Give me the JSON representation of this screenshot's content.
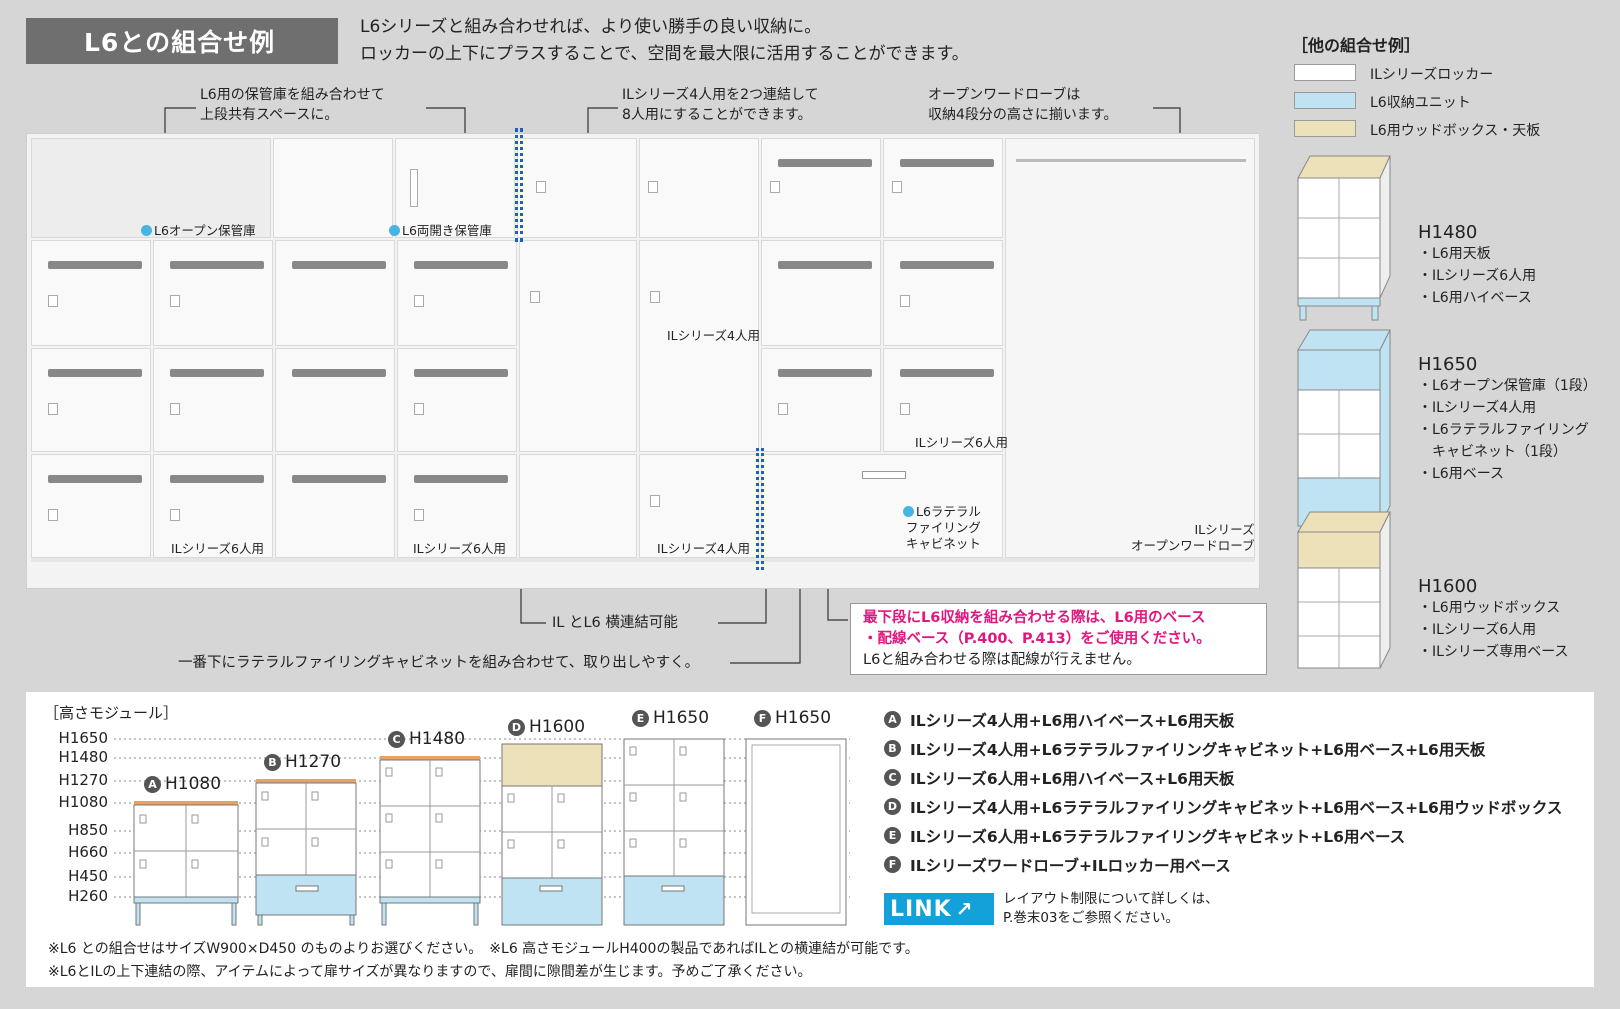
{
  "header": {
    "title": "L6との組合せ例",
    "intro_line1": "L6シリーズと組み合わせれば、より使い勝手の良い収納に。",
    "intro_line2": "ロッカーの上下にプラスすることで、空間を最大限に活用することができます。"
  },
  "callouts": {
    "c1_line1": "L6用の保管庫を組み合わせて",
    "c1_line2": "上段共有スペースに。",
    "c2_line1": "ILシリーズ4人用を2つ連結して",
    "c2_line2": "8人用にすることができます。",
    "c3_line1": "オープンワードローブは",
    "c3_line2": "収納4段分の高さに揃います。",
    "horizontal": "IL とL6 横連結可能",
    "lateral": "一番下にラテラルファイリングキャビネットを組み合わせて、取り出しやすく。"
  },
  "photo_labels": {
    "open_storage": "L6オープン保管庫",
    "double_door": "L6両開き保管庫",
    "il4_mid": "ILシリーズ4人用",
    "il6_right": "ILシリーズ6人用",
    "il6_bottom1": "ILシリーズ6人用",
    "il6_bottom2": "ILシリーズ6人用",
    "il4_bottom": "ILシリーズ4人用",
    "lateral_l1": "L6ラテラル",
    "lateral_l2": "ファイリング",
    "lateral_l3": "キャビネット",
    "wardrobe_l1": "ILシリーズ",
    "wardrobe_l2": "オープンワードローブ"
  },
  "warning": {
    "line1": "最下段にL6収納を組み合わせる際は、L6用のベース",
    "line2": "・配線ベース（P.400、P.413）をご使用ください。",
    "line3": "L6と組み合わせる際は配線が行えません。"
  },
  "right_panel": {
    "heading": "［他の組合せ例］",
    "legend": [
      {
        "label": "ILシリーズロッカー",
        "color": "#ffffff"
      },
      {
        "label": "L6収納ユニット",
        "color": "#bfe3f2"
      },
      {
        "label": "L6用ウッドボックス・天板",
        "color": "#ece1b8"
      }
    ],
    "examples": [
      {
        "height": "H1480",
        "items": [
          "・L6用天板",
          "・ILシリーズ6人用",
          "・L6用ハイベース"
        ]
      },
      {
        "height": "H1650",
        "items": [
          "・L6オープン保管庫（1段）",
          "・ILシリーズ4人用",
          "・L6ラテラルファイリング",
          "　キャビネット（1段）",
          "・L6用ベース"
        ]
      },
      {
        "height": "H1600",
        "items": [
          "・L6用ウッドボックス",
          "・ILシリーズ6人用",
          "・ILシリーズ専用ベース"
        ]
      }
    ]
  },
  "module": {
    "heading": "［高さモジュール］",
    "levels": [
      "H1650",
      "H1480",
      "H1270",
      "H1080",
      "H850",
      "H660",
      "H450",
      "H260"
    ],
    "cabinets": [
      {
        "letter": "A",
        "height": "H1080"
      },
      {
        "letter": "B",
        "height": "H1270"
      },
      {
        "letter": "C",
        "height": "H1480"
      },
      {
        "letter": "D",
        "height": "H1600"
      },
      {
        "letter": "E",
        "height": "H1650"
      },
      {
        "letter": "F",
        "height": "H1650"
      }
    ],
    "legend": [
      {
        "letter": "A",
        "text": "ILシリーズ4人用+L6用ハイベース+L6用天板"
      },
      {
        "letter": "B",
        "text": "ILシリーズ4人用+L6ラテラルファイリングキャビネット+L6用ベース+L6用天板"
      },
      {
        "letter": "C",
        "text": "ILシリーズ6人用+L6用ハイベース+L6用天板"
      },
      {
        "letter": "D",
        "text": "ILシリーズ4人用+L6ラテラルファイリングキャビネット+L6用ベース+L6用ウッドボックス"
      },
      {
        "letter": "E",
        "text": "ILシリーズ6人用+L6ラテラルファイリングキャビネット+L6用ベース"
      },
      {
        "letter": "F",
        "text": "ILシリーズワードローブ+ILロッカー用ベース"
      }
    ],
    "link_logo": "LINK",
    "link_line1": "レイアウト制限について詳しくは、",
    "link_line2": "P.巻末03をご参照ください。"
  },
  "notes": {
    "note1": "※L6 との組合せはサイズW900×D450 のものよりお選びください。　※L6 高さモジュールH400の製品であればILとの横連結が可能です。",
    "note2": "※L6とILの上下連結の際、アイテムによって扉サイズが異なりますので、扉間に隙間差が生じます。予めご了承ください。"
  }
}
